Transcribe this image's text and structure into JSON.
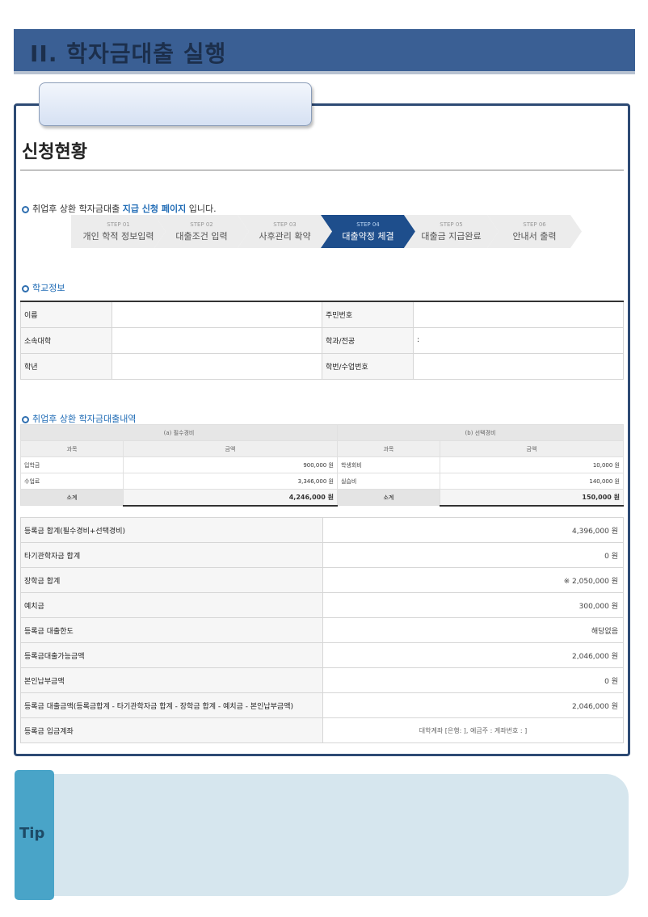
{
  "banner": {
    "title": "II. 학자금대출 실행"
  },
  "page": {
    "heading": "신청현황"
  },
  "intro": {
    "prefix": "취업후 상환 학자금대출",
    "highlight": "지급 신청 페이지",
    "suffix": "입니다."
  },
  "steps": [
    {
      "num": "STEP 01",
      "label": "개인 학적 정보입력",
      "active": false
    },
    {
      "num": "STEP 02",
      "label": "대출조건 입력",
      "active": false
    },
    {
      "num": "STEP 03",
      "label": "사후관리 확약",
      "active": false
    },
    {
      "num": "STEP 04",
      "label": "대출약정 체결",
      "active": true
    },
    {
      "num": "STEP 05",
      "label": "대출금 지급완료",
      "active": false
    },
    {
      "num": "STEP 06",
      "label": "안내서 출력",
      "active": false
    }
  ],
  "school_info": {
    "title": "학교정보",
    "rows": [
      {
        "l1": "이름",
        "v1": "",
        "l2": "주민번호",
        "v2": ""
      },
      {
        "l1": "소속대학",
        "v1": "",
        "l2": "학과/전공",
        "v2": ":"
      },
      {
        "l1": "학년",
        "v1": "",
        "l2": "학번/수업번호",
        "v2": ""
      }
    ]
  },
  "loan_detail": {
    "title": "취업후 상환 학자금대출내역",
    "section_a": "(a) 필수경비",
    "section_b": "(b) 선택경비",
    "col_item": "과목",
    "col_amount": "금액",
    "rows": [
      {
        "a_item": "입학금",
        "a_amt": "900,000 원",
        "b_item": "학생회비",
        "b_amt": "10,000 원"
      },
      {
        "a_item": "수업료",
        "a_amt": "3,346,000 원",
        "b_item": "실습비",
        "b_amt": "140,000 원"
      }
    ],
    "subtotal_label": "소계",
    "a_subtotal": "4,246,000 원",
    "b_subtotal": "150,000 원"
  },
  "summary": [
    {
      "label": "등록금 합계(필수경비+선택경비)",
      "value": "4,396,000 원"
    },
    {
      "label": "타기관학자금 합계",
      "value": "0 원"
    },
    {
      "label": "장학금 합계",
      "value": "※ 2,050,000 원"
    },
    {
      "label": "예치금",
      "value": "300,000 원"
    },
    {
      "label": "등록금 대출한도",
      "value": "해당없음"
    },
    {
      "label": "등록금대출가능금액",
      "value": "2,046,000 원"
    },
    {
      "label": "본인납부금액",
      "value": "0 원"
    },
    {
      "label": "등록금 대출금액(등록금합계 - 타기관학자금 합계 - 장학금 합계 - 예치금 - 본인납부금액)",
      "value": "2,046,000 원"
    }
  ],
  "account": {
    "label": "등록금 입금계좌",
    "value": "대학계좌 [은행:          ], 예금주           : 계좌번호 : ]"
  },
  "tip": {
    "label": "Tip"
  }
}
